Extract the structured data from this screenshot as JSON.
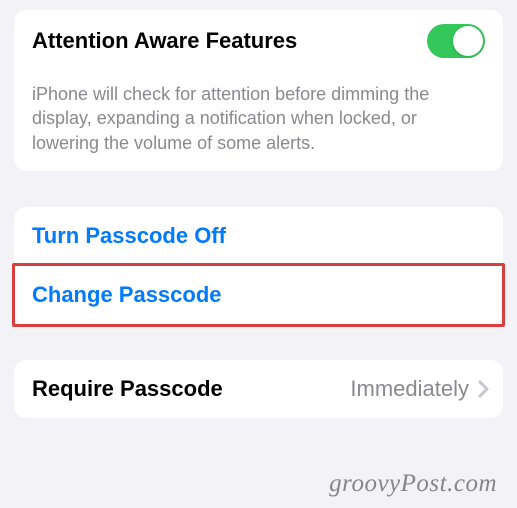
{
  "attention": {
    "title": "Attention Aware Features",
    "toggleOn": true,
    "description": "iPhone will check for attention before dimming the display, expanding a notification when locked, or lowering the volume of some alerts."
  },
  "passcodeActions": {
    "turnOff": "Turn Passcode Off",
    "change": "Change Passcode"
  },
  "requirePasscode": {
    "label": "Require Passcode",
    "value": "Immediately"
  },
  "watermark": "groovyPost.com"
}
